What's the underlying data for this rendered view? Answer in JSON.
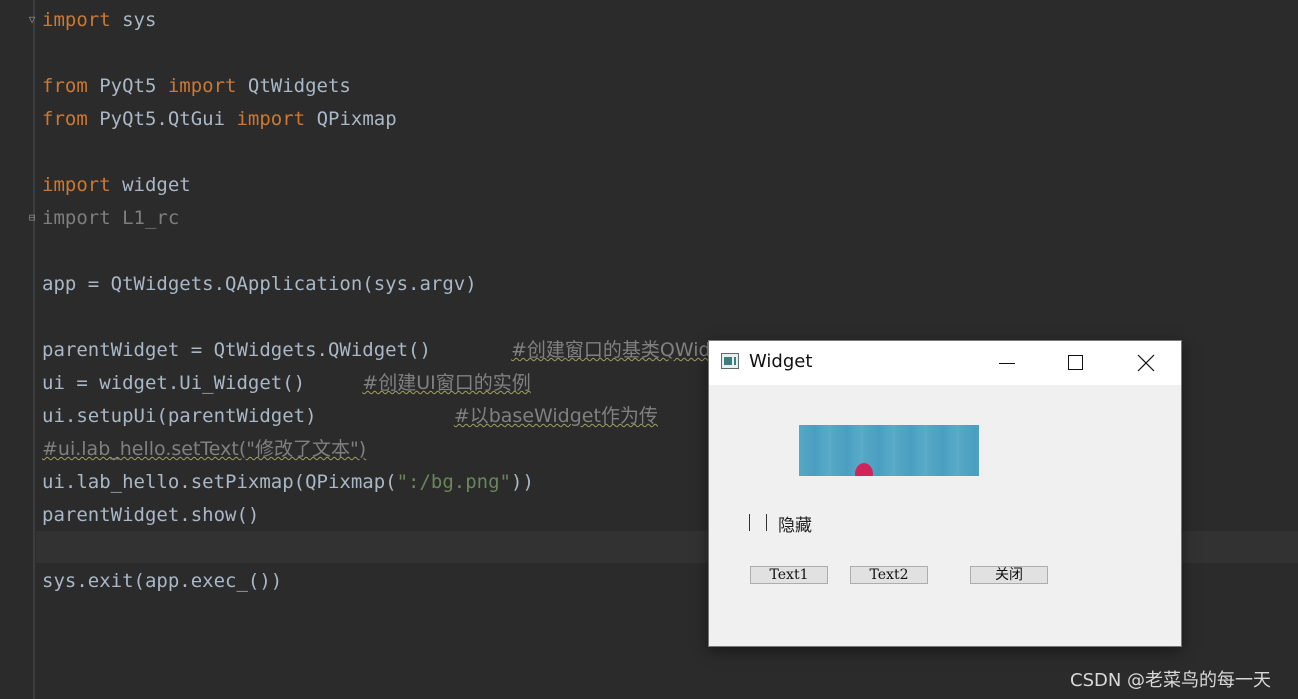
{
  "editor": {
    "lines": {
      "l1": {
        "kw1": "import",
        "t1": " sys"
      },
      "l3": {
        "kw1": "from",
        "t1": " PyQt5 ",
        "kw2": "import",
        "t2": " QtWidgets"
      },
      "l4": {
        "kw1": "from",
        "t1": " PyQt5.QtGui ",
        "kw2": "import",
        "t2": " QPixmap"
      },
      "l6": {
        "kw1": "import",
        "t1": " widget"
      },
      "l7": {
        "t1": "import L1_rc"
      },
      "l9": {
        "t1": "app = QtWidgets.QApplication(sys.argv)"
      },
      "l11": {
        "t1": "parentWidget = QtWidgets.QWidget()       ",
        "c1": "#创建窗口的基类QWid"
      },
      "l12": {
        "t1": "ui = widget.Ui_Widget()     ",
        "c1": "#创建UI窗口的实例"
      },
      "l13": {
        "t1": "ui.setupUi(parentWidget)            ",
        "c1": "#以baseWidget作为传"
      },
      "l14": {
        "c1": "#ui.lab_hello.setText(\"修改了文本\")"
      },
      "l15": {
        "t1": "ui.lab_hello.setPixmap(QPixmap(",
        "s1": "\":/bg.png\"",
        "t2": "))"
      },
      "l16": {
        "t1": "parentWidget.show()"
      },
      "l18": {
        "t1": "sys.exit(app.exec_())"
      }
    }
  },
  "window": {
    "title": "Widget",
    "checkbox_label": "隐藏",
    "buttons": {
      "text1": "Text1",
      "text2": "Text2",
      "close": "关闭"
    }
  },
  "watermark": "CSDN @老菜鸟的每一天",
  "colors": {
    "keyword": "#cc7832",
    "text": "#a9b7c6",
    "string": "#6a8759",
    "comment": "#808080",
    "editor_bg": "#2b2b2b"
  }
}
